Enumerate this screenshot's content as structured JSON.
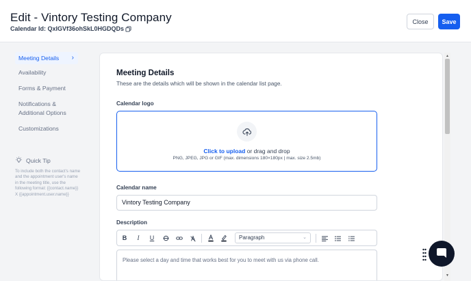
{
  "header": {
    "title": "Edit - Vintory Testing Company",
    "calendar_id": "Calendar Id: QxIGVf36ohSkL0HGDQDs",
    "close_label": "Close",
    "save_label": "Save"
  },
  "sidebar": {
    "items": [
      {
        "label": "Meeting Details",
        "active": true
      },
      {
        "label": "Availability"
      },
      {
        "label": "Forms & Payment"
      },
      {
        "label": "Notifications & Additional Options"
      },
      {
        "label": "Customizations"
      }
    ],
    "quick_tip": {
      "title": "Quick Tip",
      "body": "To include both the contact's name and the appointment user's name in the meeting title, use the following format: {{contact.name}} X {{appointment.user.name}}"
    }
  },
  "main": {
    "title": "Meeting Details",
    "subtitle": "These are the details which will be shown in the calendar list page.",
    "logo": {
      "label": "Calendar logo",
      "upload_link": "Click to upload",
      "upload_rest": " or drag and drop",
      "hint": "PNG, JPEG, JPG or GIF (max. dimensions 180×180px | max. size 2.5mb)"
    },
    "name": {
      "label": "Calendar name",
      "value": "Vintory Testing Company"
    },
    "description": {
      "label": "Description",
      "toolbar": {
        "bold": "B",
        "italic": "I",
        "underline": "U",
        "paragraph": "Paragraph"
      },
      "value": "Please select a day and time that works best for you to meet with us via phone call."
    }
  },
  "colors": {
    "primary": "#155eef",
    "chat": "#0f172a"
  }
}
